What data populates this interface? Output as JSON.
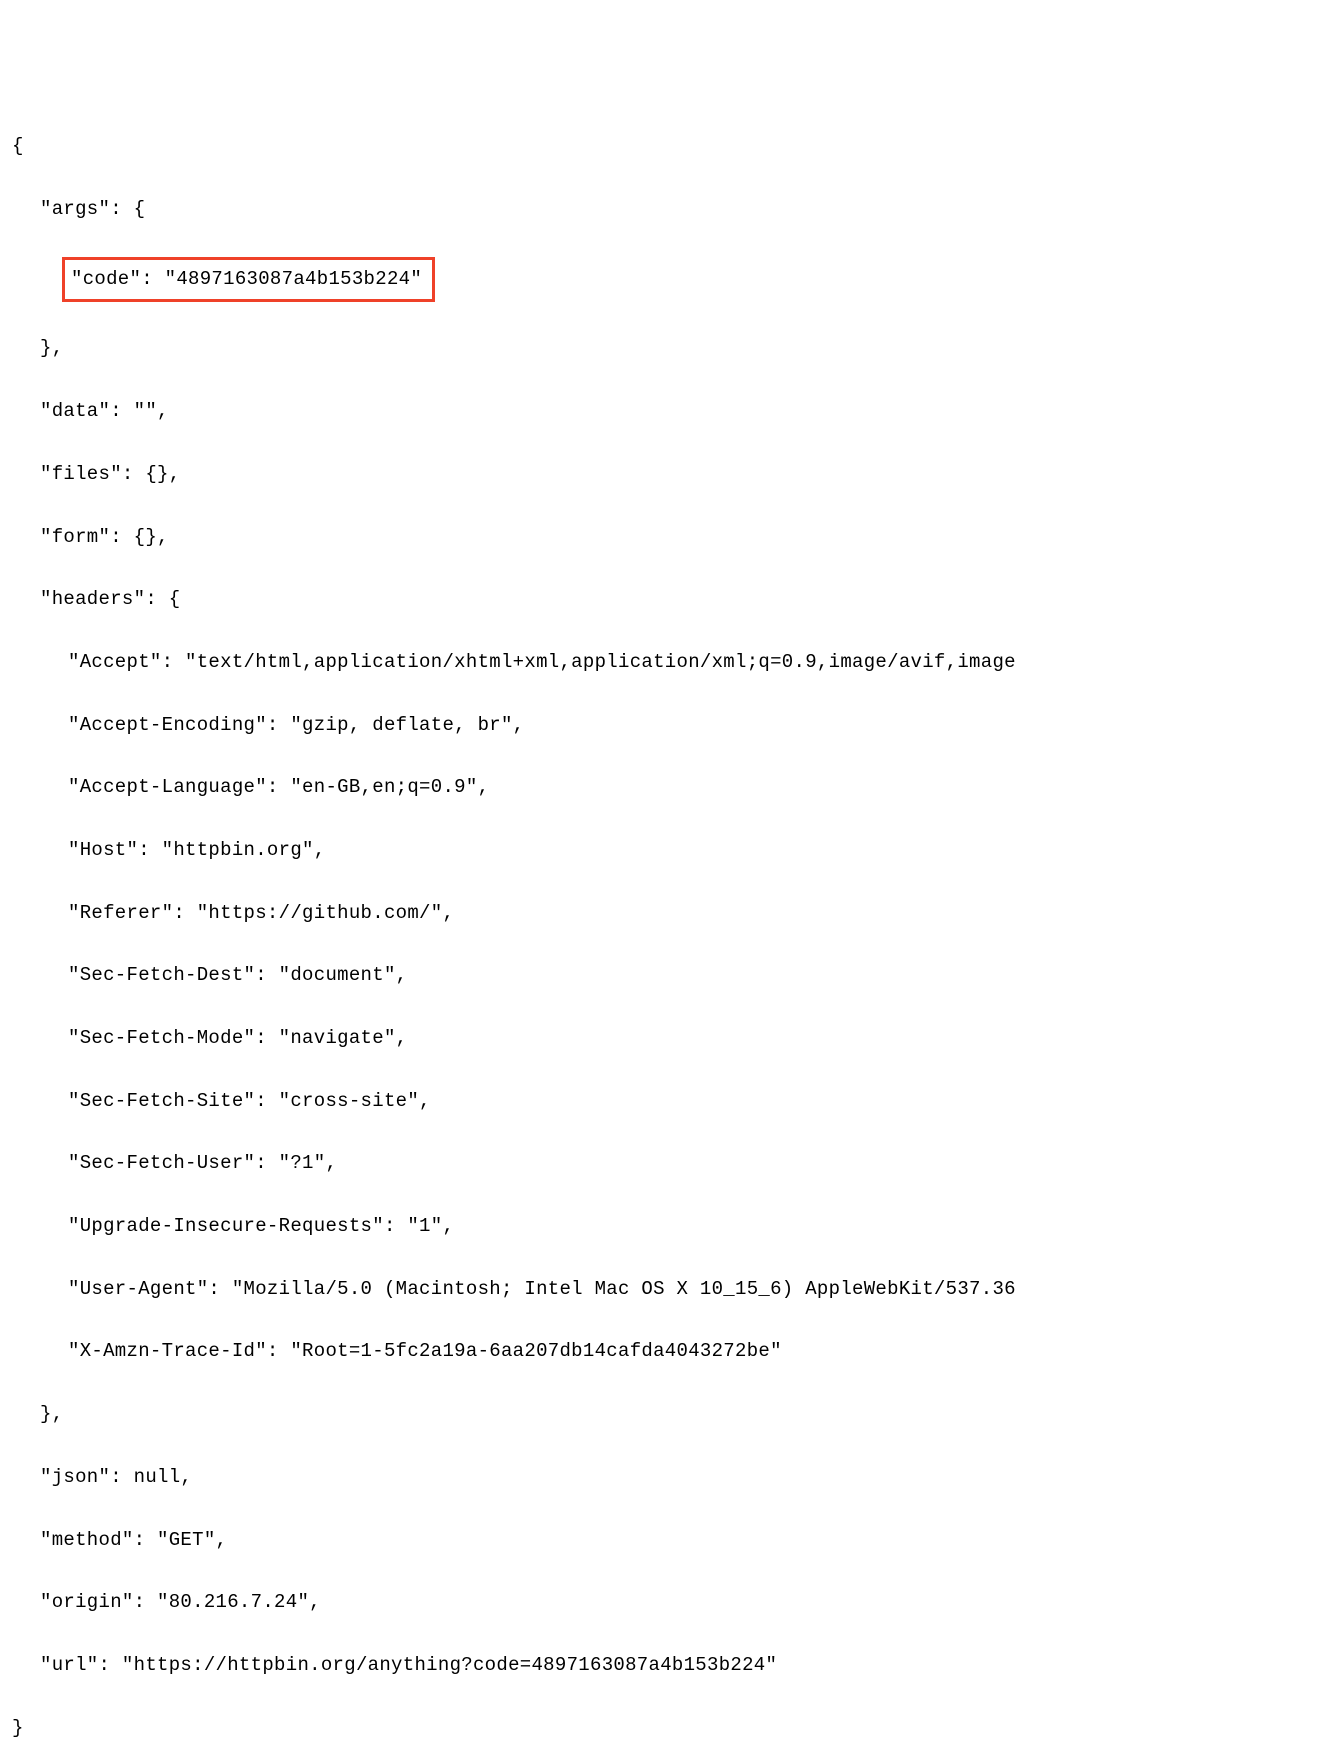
{
  "json_display": {
    "open_brace": "{",
    "args_line": "\"args\": {",
    "code_line": "\"code\": \"4897163087a4b153b224\"",
    "args_close": "},",
    "data_line": "\"data\": \"\",",
    "files_line": "\"files\": {},",
    "form_line": "\"form\": {},",
    "headers_line": "\"headers\": {",
    "accept_line": "\"Accept\": \"text/html,application/xhtml+xml,application/xml;q=0.9,image/avif,image",
    "accept_encoding_line": "\"Accept-Encoding\": \"gzip, deflate, br\",",
    "accept_language_line": "\"Accept-Language\": \"en-GB,en;q=0.9\",",
    "host_line": "\"Host\": \"httpbin.org\",",
    "referer_line": "\"Referer\": \"https://github.com/\",",
    "sec_fetch_dest_line": "\"Sec-Fetch-Dest\": \"document\",",
    "sec_fetch_mode_line": "\"Sec-Fetch-Mode\": \"navigate\",",
    "sec_fetch_site_line": "\"Sec-Fetch-Site\": \"cross-site\",",
    "sec_fetch_user_line": "\"Sec-Fetch-User\": \"?1\",",
    "upgrade_line": "\"Upgrade-Insecure-Requests\": \"1\",",
    "user_agent_line": "\"User-Agent\": \"Mozilla/5.0 (Macintosh; Intel Mac OS X 10_15_6) AppleWebKit/537.36",
    "trace_id_line": "\"X-Amzn-Trace-Id\": \"Root=1-5fc2a19a-6aa207db14cafda4043272be\"",
    "headers_close": "},",
    "json_line": "\"json\": null,",
    "method_line": "\"method\": \"GET\",",
    "origin_line": "\"origin\": \"80.216.7.24\",",
    "url_line": "\"url\": \"https://httpbin.org/anything?code=4897163087a4b153b224\"",
    "close_brace": "}"
  }
}
